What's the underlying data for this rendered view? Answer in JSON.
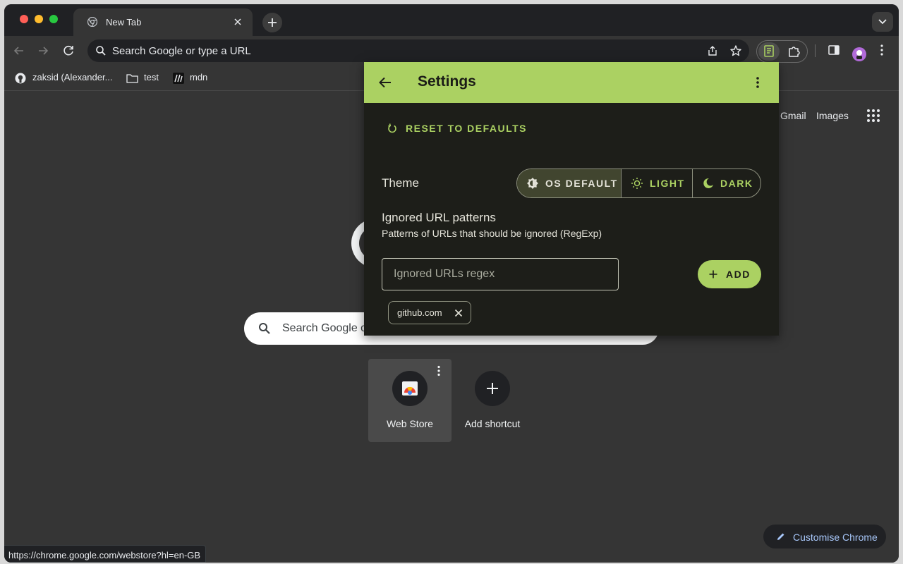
{
  "browser": {
    "tab": {
      "title": "New Tab"
    },
    "omnibox": {
      "placeholder": "Search Google or type a URL"
    },
    "bookmarks": [
      {
        "label": "zaksid (Alexander...",
        "icon": "github-icon"
      },
      {
        "label": "test",
        "icon": "folder-icon"
      },
      {
        "label": "mdn",
        "icon": "mdn-icon"
      }
    ]
  },
  "ntp": {
    "links": {
      "gmail": "Gmail",
      "images": "Images"
    },
    "search_placeholder": "Search Google o",
    "shortcuts": [
      {
        "label": "Web Store"
      },
      {
        "label": "Add shortcut"
      }
    ],
    "customise_label": "Customise Chrome",
    "status_url": "https://chrome.google.com/webstore?hl=en-GB"
  },
  "popup": {
    "title": "Settings",
    "reset_label": "RESET TO DEFAULTS",
    "theme": {
      "label": "Theme",
      "options": [
        "OS DEFAULT",
        "LIGHT",
        "DARK"
      ],
      "selected": "OS DEFAULT"
    },
    "ignored": {
      "title": "Ignored URL patterns",
      "subtitle": "Patterns of URLs that should be ignored (RegExp)",
      "input_value": "",
      "input_placeholder": "Ignored URLs regex",
      "add_label": "ADD",
      "chips": [
        "github.com"
      ]
    }
  },
  "colors": {
    "accent": "#abd162",
    "popup_bg": "#1d1e19",
    "browser_bg": "#353535",
    "tabstrip_bg": "#202124"
  }
}
